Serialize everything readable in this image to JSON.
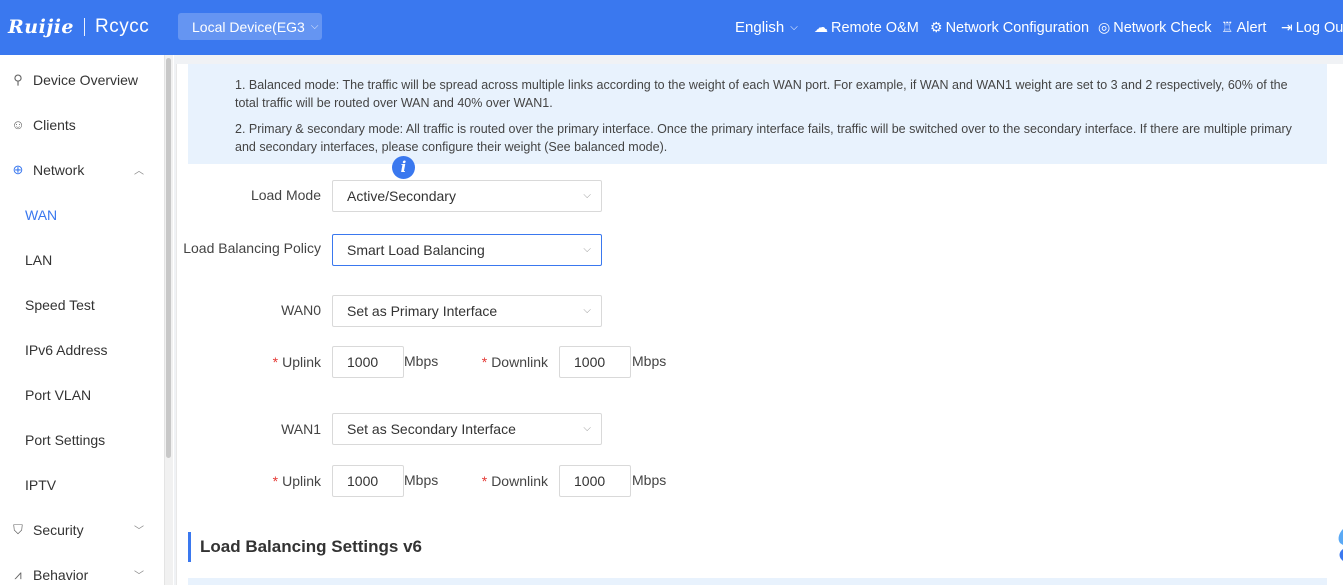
{
  "header": {
    "brand": "Ruijie",
    "product": "Rcycc",
    "device_select": "Local Device(EG3",
    "language": "English",
    "nav": [
      {
        "label": "Remote O&M",
        "icon": "cloud-icon"
      },
      {
        "label": "Network Configuration",
        "icon": "network-config-icon"
      },
      {
        "label": "Network Check",
        "icon": "network-check-icon"
      },
      {
        "label": "Alert",
        "icon": "alert-icon"
      },
      {
        "label": "Log Out",
        "icon": "logout-icon"
      }
    ]
  },
  "sidebar": {
    "items": [
      {
        "label": "Device Overview",
        "icon": "topology-icon"
      },
      {
        "label": "Clients",
        "icon": "user-icon"
      },
      {
        "label": "Network",
        "icon": "globe-icon",
        "expanded": true
      },
      {
        "label": "WAN",
        "active": true
      },
      {
        "label": "LAN"
      },
      {
        "label": "Speed Test"
      },
      {
        "label": "IPv6 Address"
      },
      {
        "label": "Port VLAN"
      },
      {
        "label": "Port Settings"
      },
      {
        "label": "IPTV"
      },
      {
        "label": "Security",
        "icon": "shield-icon"
      },
      {
        "label": "Behavior",
        "icon": "chart-icon"
      }
    ]
  },
  "notice": {
    "line1": "1. Balanced mode: The traffic will be spread across multiple links according to the weight of each WAN port. For example, if WAN and WAN1 weight are set to 3 and 2 respectively, 60% of the total traffic will be routed over WAN and 40% over WAN1.",
    "line2": "2. Primary & secondary mode: All traffic is routed over the primary interface. Once the primary interface fails, traffic will be switched over to the secondary interface. If there are multiple primary and secondary interfaces, please configure their weight (See balanced mode)."
  },
  "form": {
    "load_mode_label": "Load Mode",
    "load_mode_value": "Active/Secondary",
    "policy_label": "Load Balancing Policy",
    "policy_value": "Smart Load Balancing",
    "wan0_label": "WAN0",
    "wan0_value": "Set as Primary Interface",
    "wan0_uplink_label": "Uplink",
    "wan0_uplink_value": "1000",
    "wan0_downlink_label": "Downlink",
    "wan0_downlink_value": "1000",
    "wan1_label": "WAN1",
    "wan1_value": "Set as Secondary Interface",
    "wan1_uplink_label": "Uplink",
    "wan1_uplink_value": "1000",
    "wan1_downlink_label": "Downlink",
    "wan1_downlink_value": "1000",
    "unit": "Mbps",
    "required_mark": "*"
  },
  "section_v6": {
    "title": "Load Balancing Settings v6"
  },
  "colors": {
    "accent": "#3a78ef",
    "notice_bg": "#e8f2fd",
    "required": "#e53935"
  }
}
